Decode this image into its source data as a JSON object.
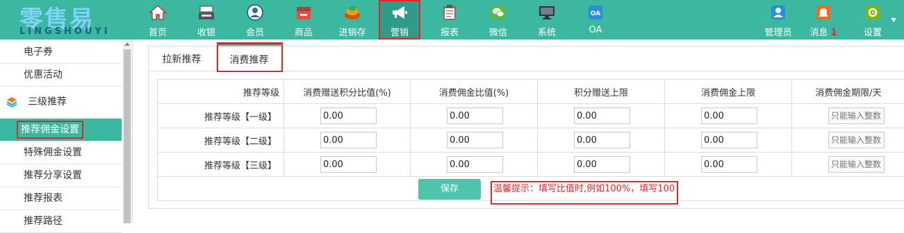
{
  "logo": {
    "zh": "零售易",
    "en": "LINGSHOUYI"
  },
  "nav": {
    "items": [
      {
        "label": "首页",
        "icon": "home-icon"
      },
      {
        "label": "收银",
        "icon": "cash-register-icon"
      },
      {
        "label": "会员",
        "icon": "user-icon"
      },
      {
        "label": "商品",
        "icon": "goods-box-icon"
      },
      {
        "label": "进销存",
        "icon": "inventory-icon"
      },
      {
        "label": "营销",
        "icon": "megaphone-icon"
      },
      {
        "label": "报表",
        "icon": "report-clipboard-icon"
      },
      {
        "label": "微信",
        "icon": "wechat-icon"
      },
      {
        "label": "系统",
        "icon": "monitor-icon"
      },
      {
        "label": "OA",
        "icon": "oa-icon"
      }
    ],
    "active": "营销",
    "right": {
      "admin": "管理员",
      "messages": "消息",
      "message_count": "1",
      "settings": "设置"
    }
  },
  "sidebar": {
    "items": [
      "电子券",
      "优惠活动"
    ],
    "group": "三级推荐",
    "sub_items": [
      "推荐佣金设置",
      "特殊佣金设置",
      "推荐分享设置",
      "推荐报表",
      "推荐路径"
    ],
    "active": "推荐佣金设置"
  },
  "tabs": [
    "拉新推荐",
    "消费推荐"
  ],
  "active_tab": "消费推荐",
  "table": {
    "headers": [
      "推荐等级",
      "消费赠送积分比值(%)",
      "消费佣金比值(%)",
      "积分赠送上限",
      "消费佣金上限",
      "消费佣金期限/天"
    ],
    "rows": [
      {
        "level": "推荐等级【一级】",
        "values": [
          "0.00",
          "0.00",
          "0.00",
          "0.00"
        ],
        "placeholder": "只能输入整数"
      },
      {
        "level": "推荐等级【二级】",
        "values": [
          "0.00",
          "0.00",
          "0.00",
          "0.00"
        ],
        "placeholder": "只能输入整数"
      },
      {
        "level": "推荐等级【三级】",
        "values": [
          "0.00",
          "0.00",
          "0.00",
          "0.00"
        ],
        "placeholder": "只能输入整数"
      }
    ]
  },
  "save_label": "保存",
  "tip": "温馨提示：填写比值时,例如100%，填写100",
  "colors": {
    "primary": "#3cb8a1",
    "highlight": "#e0262a"
  }
}
